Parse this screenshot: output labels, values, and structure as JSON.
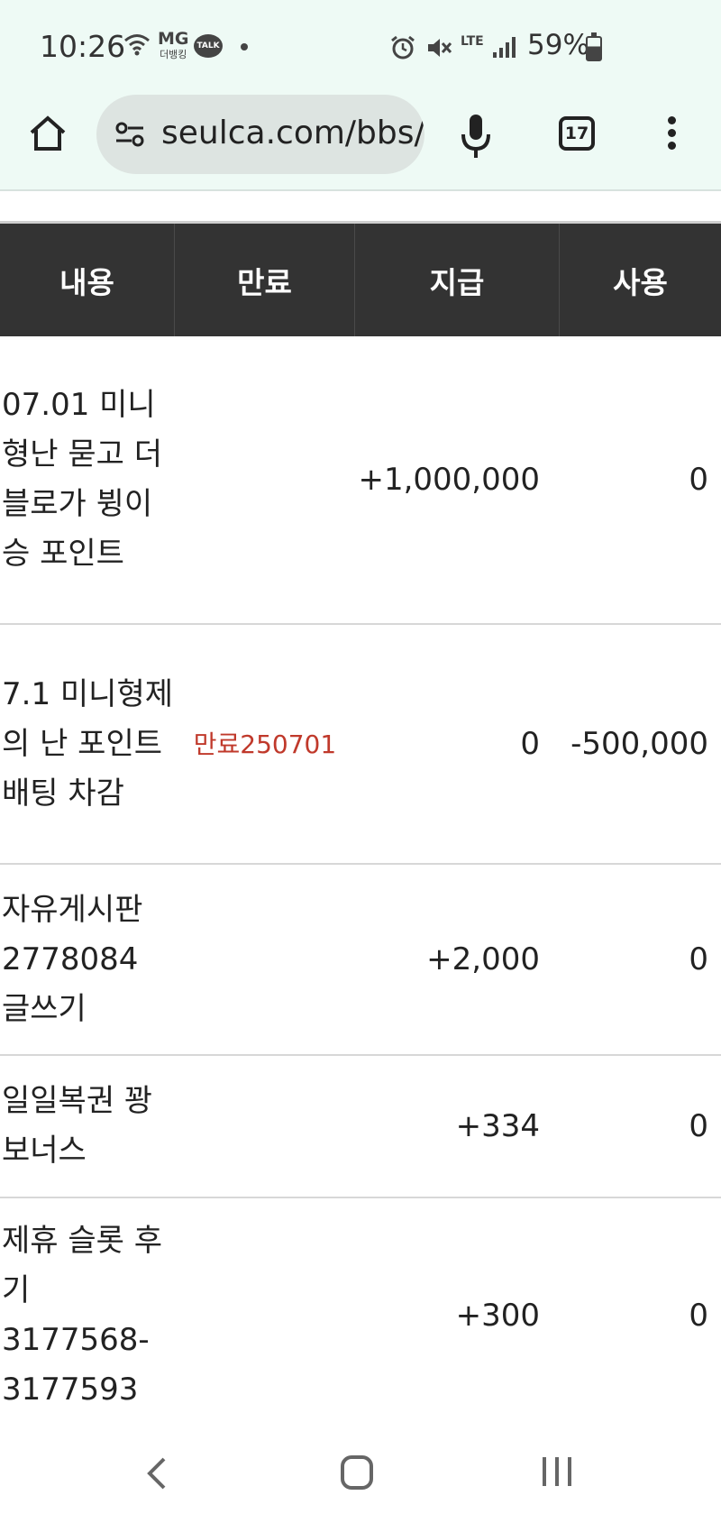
{
  "status": {
    "time": "10:26",
    "carrier": "MG",
    "carrier_sub": "더뱅킹",
    "talk": "TALK",
    "network": "LTE",
    "battery": "59%"
  },
  "browser": {
    "url": "seulca.com/bbs/",
    "tab_count": "17"
  },
  "table": {
    "headers": [
      "내용",
      "만료",
      "지급",
      "사용"
    ],
    "rows": [
      {
        "content": "07.01 미니형난 묻고 더블로가 뷩이승 포인트",
        "expire": "",
        "give": "+1,000,000",
        "use": "0"
      },
      {
        "content": "7.1 미니형제의 난 포인트 배팅 차감",
        "expire": "만료250701",
        "give": "0",
        "use": "-500,000"
      },
      {
        "content": "자유게시판 2778084 글쓰기",
        "expire": "",
        "give": "+2,000",
        "use": "0"
      },
      {
        "content": "일일복권 꽝 보너스",
        "expire": "",
        "give": "+334",
        "use": "0"
      },
      {
        "content": "제휴 슬롯 후기 3177568-3177593",
        "expire": "",
        "give": "+300",
        "use": "0"
      }
    ]
  },
  "colors": {
    "header_bg": "#333333",
    "expire_red": "#c0392b",
    "chrome_bg": "#eefaf5"
  }
}
